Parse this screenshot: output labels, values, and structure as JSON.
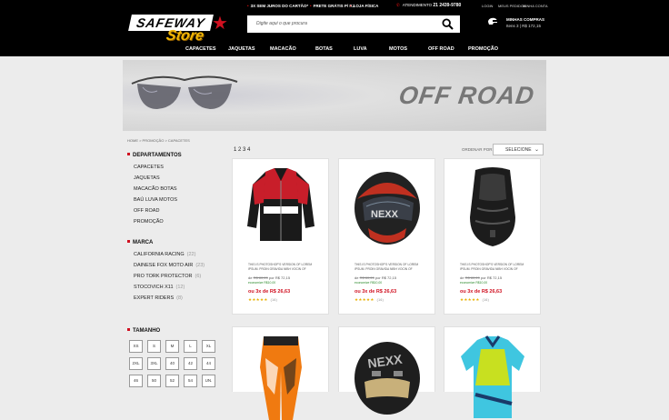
{
  "header": {
    "logo_text_1": "SAFEWAY",
    "logo_text_2": "Store",
    "promos": [
      "3X SEM JUROS DO CARTÃO*",
      "FRETE GRÁTIS P/ RJ",
      "LOJA FÍSICA"
    ],
    "phone_label": "ATENDIMENTO",
    "phone_number": "21 2439-9780",
    "account_links": [
      "LOGIN",
      "MEUS PEDIDOS",
      "MINHA CONTA"
    ],
    "search_placeholder": "Digite aqui o que procura",
    "cart_title": "MINHAS COMPRAS",
    "cart_summary": "Itens 3  |  R$ 172,15"
  },
  "nav": [
    "CAPACETES",
    "JAQUETAS",
    "MACACÃO",
    "BOTAS",
    "LUVA",
    "MOTOS",
    "OFF ROAD",
    "PROMOÇÃO"
  ],
  "banner": {
    "title": "OFF ROAD"
  },
  "breadcrumb": "HOME  >  PROMOÇÃO  >  CAPACETES",
  "pagination": "1 2 3 4",
  "sort": {
    "label": "ORDENAR POR",
    "selected": "SELECIONE"
  },
  "sidebar": {
    "departments_title": "DEPARTAMENTOS",
    "departments": [
      "CAPACETES",
      "JAQUETAS",
      "MACACÃO BOTAS",
      "BAÚ LUVA MOTOS",
      "OFF ROAD",
      "PROMOÇÃO"
    ],
    "brand_title": "MARCA",
    "brands": [
      {
        "name": "CALIFORNIA RACING",
        "count": "(22)"
      },
      {
        "name": "DAINESE   FOX   MOTO AIR",
        "count": "(23)"
      },
      {
        "name": "PRO TORK  PROTECTOR",
        "count": "(6)"
      },
      {
        "name": "STOCOVICH X11",
        "count": "(12)"
      },
      {
        "name": "EXPERT RIDERS",
        "count": "(8)"
      }
    ],
    "size_title": "TAMANHO",
    "sizes": [
      "XS",
      "S",
      "M",
      "L",
      "XL",
      "2XL",
      "3XL",
      "40",
      "42",
      "44",
      "46",
      "50",
      "52",
      "54",
      "UN."
    ]
  },
  "products": [
    {
      "desc": "THIS IS PHOTOSHOP'S VERSION  OF LOREM IPSUM. PROIN GRAVIDA NIBH VOCIN  OF",
      "old_price": "R$ 80,20",
      "price_prefix": "por",
      "price": "R$ 72,15",
      "economy": "economize R$10,00",
      "installments": "ou 3x de R$ 26,63",
      "stars": "★★★★★",
      "reviews": "(16)",
      "colors": {
        "main": "#c81e2a",
        "alt": "#1a1a1a"
      }
    },
    {
      "desc": "THIS IS PHOTOSHOP'S VERSION  OF LOREM IPSUM. PROIN GRAVIDA NIBH VOCIN  OF",
      "old_price": "R$ 80,20",
      "price_prefix": "por",
      "price": "R$ 72,15",
      "economy": "economize R$10,00",
      "installments": "ou 3x de R$ 26,63",
      "stars": "★★★★★",
      "reviews": "(16)",
      "colors": {
        "main": "#222222",
        "alt": "#d23a2a"
      }
    },
    {
      "desc": "THIS IS PHOTOSHOP'S VERSION  OF LOREM IPSUM. PROIN GRAVIDA NIBH VOCIN  OF",
      "old_price": "R$ 80,20",
      "price_prefix": "por",
      "price": "R$ 72,15",
      "economy": "economize R$10,00",
      "installments": "ou 3x de R$ 26,63",
      "stars": "★★★★★",
      "reviews": "(16)",
      "colors": {
        "main": "#1c1c1c",
        "alt": "#3a3a3a"
      }
    }
  ]
}
